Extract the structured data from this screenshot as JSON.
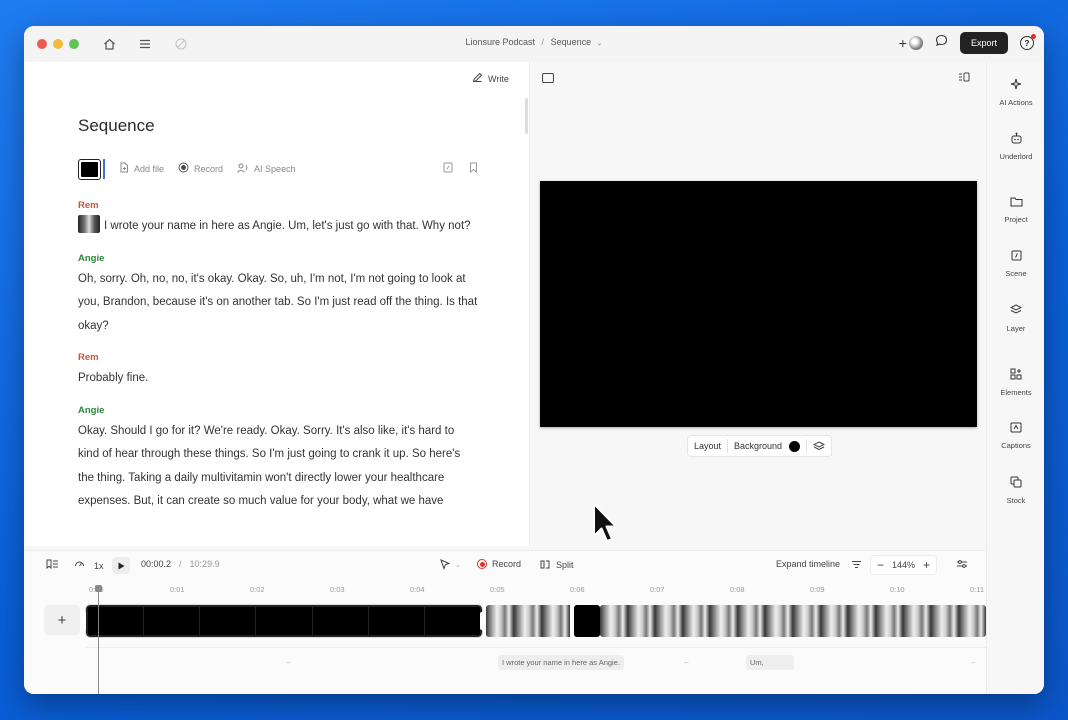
{
  "window": {
    "breadcrumb": {
      "project": "Lionsure Podcast",
      "separator": "/",
      "sequence": "Sequence"
    },
    "export_label": "Export",
    "help_label": "?"
  },
  "script": {
    "write_label": "Write",
    "title": "Sequence",
    "toolbar": {
      "add_file": "Add file",
      "record": "Record",
      "ai_speech": "AI Speech"
    },
    "entries": [
      {
        "speaker": "Rem",
        "text": "I wrote your name in here as Angie. Um, let's just go with that. Why not?"
      },
      {
        "speaker": "Angie",
        "text": "Oh, sorry. Oh, no, no, it's okay. Okay. So, uh, I'm not, I'm not going to look at you, Brandon, because it's on another tab. So I'm just read off the thing. Is that okay?"
      },
      {
        "speaker": "Rem",
        "text": "Probably fine."
      },
      {
        "speaker": "Angie",
        "text": "Okay. Should I go for it? We're ready. Okay. Sorry. It's also like, it's hard to kind of hear through these things. So I'm just going to crank it up. So here's the thing. Taking a daily multivitamin won't directly lower your healthcare expenses. But, it can create so much value for your body, what we have"
      }
    ]
  },
  "preview": {
    "layout_label": "Layout",
    "background_label": "Background",
    "background_color": "#000000"
  },
  "sidebar": [
    {
      "icon": "sparkle-icon",
      "label": "AI Actions"
    },
    {
      "icon": "robot-icon",
      "label": "Underlord"
    },
    {
      "icon": "folder-icon",
      "label": "Project"
    },
    {
      "icon": "scene-icon",
      "label": "Scene"
    },
    {
      "icon": "layers-icon",
      "label": "Layer"
    },
    {
      "icon": "elements-icon",
      "label": "Elements"
    },
    {
      "icon": "captions-icon",
      "label": "Captions"
    },
    {
      "icon": "stock-icon",
      "label": "Stock"
    }
  ],
  "timeline": {
    "speed": "1x",
    "current_time": "00:00.2",
    "time_separator": "/",
    "total_time": "10:29.9",
    "record_label": "Record",
    "split_label": "Split",
    "expand_label": "Expand timeline",
    "zoom": "144%",
    "ruler": [
      "0:00",
      "0:01",
      "0:02",
      "0:03",
      "0:04",
      "0:05",
      "0:06",
      "0:07",
      "0:08",
      "0:09",
      "0:10",
      "0:11"
    ],
    "captions": [
      {
        "text": "I wrote your name in here as Angie."
      },
      {
        "text": "Um,"
      }
    ]
  }
}
